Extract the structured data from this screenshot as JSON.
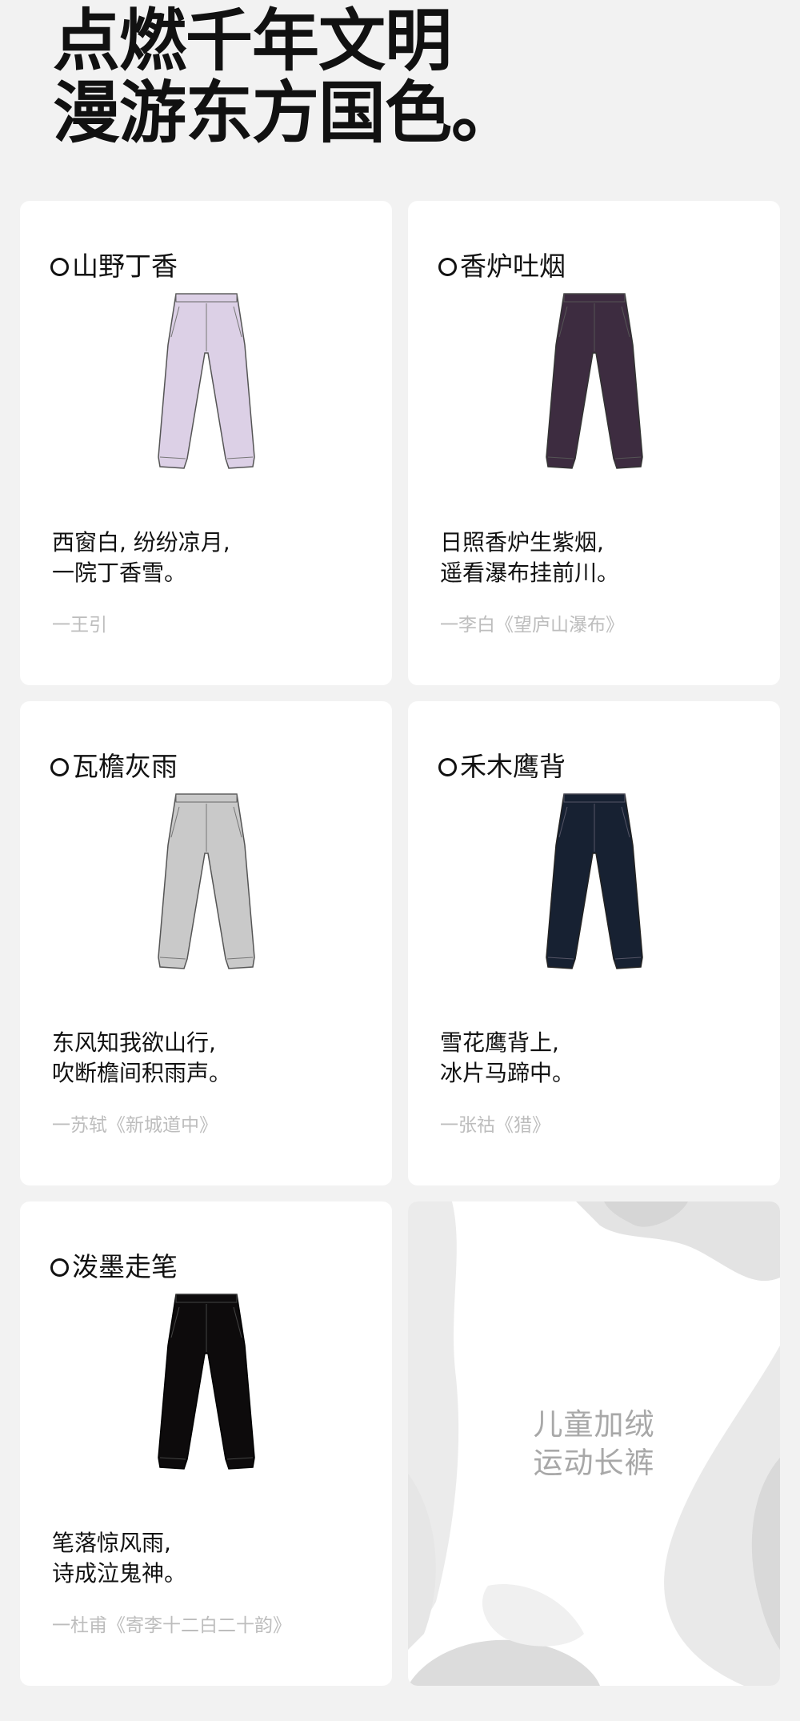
{
  "header": {
    "title_line1": "点燃千年文明",
    "title_line2": "漫游东方国色。"
  },
  "cards": [
    {
      "name": "山野丁香",
      "color": "#dcd0e6",
      "line1": "西窗白, 纷纷凉月,",
      "line2": "一院丁香雪。",
      "source": "一王引"
    },
    {
      "name": "香炉吐烟",
      "color": "#3d2c40",
      "line1": "日照香炉生紫烟,",
      "line2": "遥看瀑布挂前川。",
      "source": "一李白《望庐山瀑布》"
    },
    {
      "name": "瓦檐灰雨",
      "color": "#c9c9c9",
      "line1": "东风知我欲山行,",
      "line2": "吹断檐间积雨声。",
      "source": "一苏轼《新城道中》"
    },
    {
      "name": "禾木鹰背",
      "color": "#172132",
      "line1": "雪花鹰背上,",
      "line2": "冰片马蹄中。",
      "source": "一张祜《猎》"
    },
    {
      "name": "泼墨走笔",
      "color": "#0d0b0c",
      "line1": "笔落惊风雨,",
      "line2": "诗成泣鬼神。",
      "source": "一杜甫《寄李十二白二十韵》"
    }
  ],
  "promo": {
    "line1": "儿童加绒",
    "line2": "运动长裤"
  },
  "icons": {
    "title_marker": "circle-icon",
    "product": "pants-icon"
  }
}
